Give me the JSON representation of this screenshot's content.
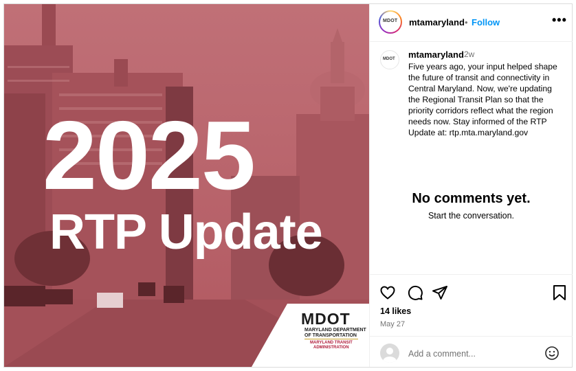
{
  "post_image": {
    "headline_year": "2025",
    "headline_text": "RTP Update",
    "logo": {
      "mark": "MDOT",
      "line1": "MARYLAND DEPARTMENT",
      "line2": "OF TRANSPORTATION",
      "line3": "MARYLAND TRANSIT",
      "line4": "ADMINISTRATION"
    }
  },
  "header": {
    "username": "mtamaryland",
    "separator": "•",
    "follow_label": "Follow",
    "more_label": "•••",
    "avatar_text": "MDOT"
  },
  "caption": {
    "username": "mtamaryland",
    "time_ago": "2w",
    "text": "Five years ago, your input helped shape the future of transit and connectivity in Central Maryland. Now, we're updating the Regional Transit Plan so that the priority corridors reflect what the region needs now. Stay informed of the RTP Update at:  rtp.mta.maryland.gov"
  },
  "comments": {
    "empty_title": "No comments yet.",
    "empty_subtitle": "Start the conversation."
  },
  "actions": {
    "icons": [
      "heart-icon",
      "comment-icon",
      "share-icon",
      "bookmark-icon"
    ],
    "likes": "14 likes",
    "date": "May 27"
  },
  "comment_input": {
    "placeholder": "Add a comment..."
  },
  "colors": {
    "follow_blue": "#0095f6",
    "image_tint": "#b65a62",
    "muted_text": "#737373"
  }
}
